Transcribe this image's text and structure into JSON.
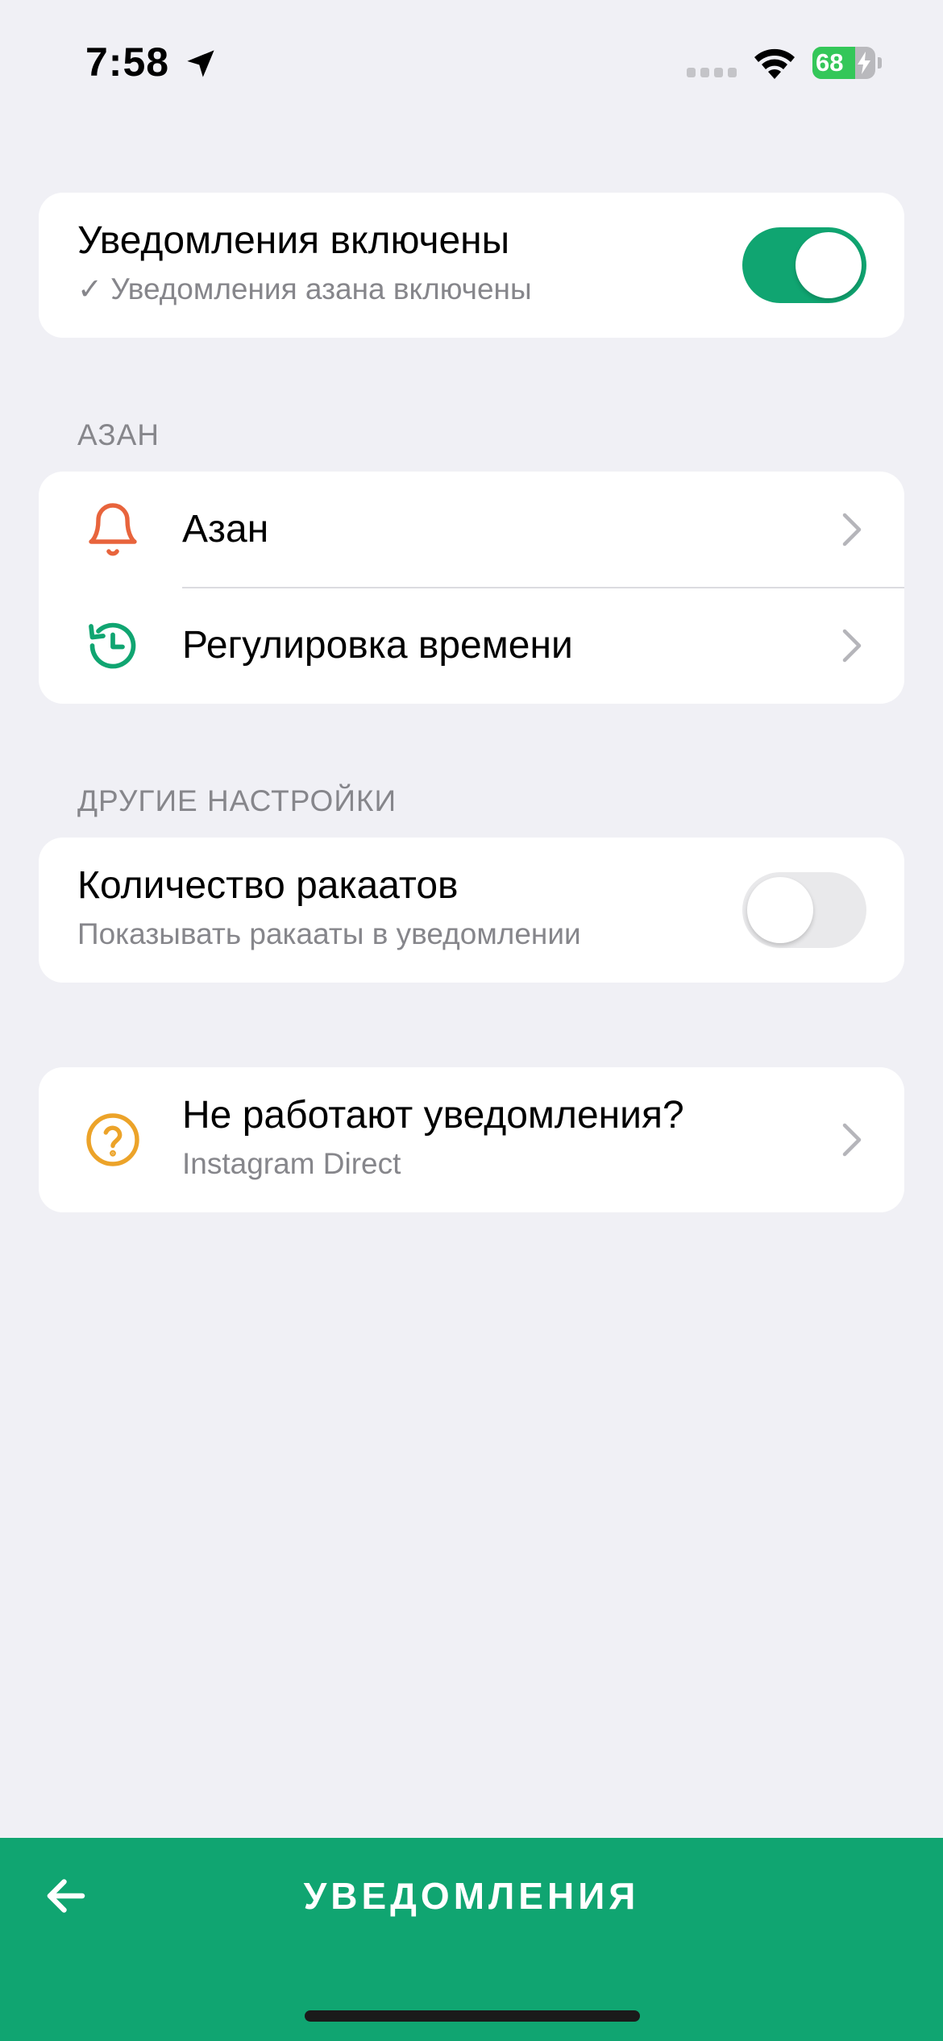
{
  "status_bar": {
    "time": "7:58",
    "battery_level": "68",
    "battery_fraction": 0.68,
    "icons": [
      "location-arrow-icon",
      "cellular-signal-icon",
      "wifi-icon",
      "battery-icon",
      "charging-bolt-icon"
    ]
  },
  "notifications_card": {
    "title": "Уведомления включены",
    "subtitle": "✓ Уведомления азана включены",
    "toggle_on": true
  },
  "azan_section": {
    "header": "АЗАН",
    "items": [
      {
        "label": "Азан",
        "icon": "bell-icon",
        "icon_color": "#e8643c"
      },
      {
        "label": "Регулировка времени",
        "icon": "history-clock-icon",
        "icon_color": "#10a571"
      }
    ]
  },
  "other_section": {
    "header": "ДРУГИЕ НАСТРОЙКИ",
    "rakaat": {
      "title": "Количество ракаатов",
      "subtitle": "Показывать ракааты в уведомлении",
      "toggle_on": false
    }
  },
  "help_card": {
    "title": "Не работают уведомления?",
    "subtitle": "Instagram Direct",
    "icon": "question-circle-icon",
    "icon_color": "#eca329"
  },
  "bottom_bar": {
    "title": "УВЕДОМЛЕНИЯ",
    "icon": "arrow-left-icon"
  },
  "colors": {
    "accent": "#10a571",
    "background": "#f0f0f5",
    "secondary_text": "#86868b"
  }
}
